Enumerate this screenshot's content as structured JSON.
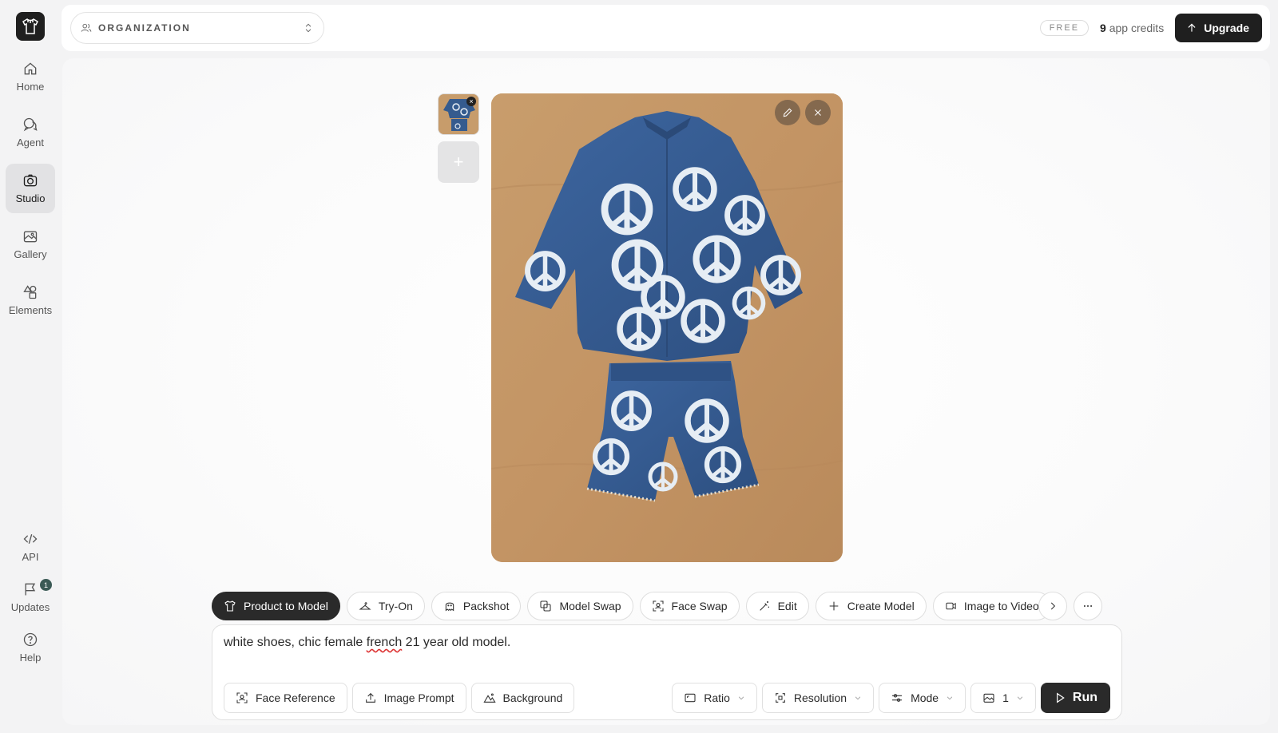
{
  "sidebar": {
    "items": [
      {
        "label": "Home",
        "icon": "home-icon"
      },
      {
        "label": "Agent",
        "icon": "chat-icon"
      },
      {
        "label": "Studio",
        "icon": "camera-icon",
        "active": true
      },
      {
        "label": "Gallery",
        "icon": "images-icon"
      },
      {
        "label": "Elements",
        "icon": "shapes-icon"
      }
    ],
    "bottom_items": [
      {
        "label": "API",
        "icon": "code-icon"
      },
      {
        "label": "Updates",
        "icon": "flag-icon",
        "badge": "1"
      },
      {
        "label": "Help",
        "icon": "help-icon"
      }
    ]
  },
  "header": {
    "org_label": "ORGANIZATION",
    "plan_badge": "FREE",
    "credits_count": "9",
    "credits_label": "app credits",
    "upgrade_label": "Upgrade"
  },
  "tools": [
    {
      "label": "Product to Model",
      "icon": "shirt-icon",
      "active": true
    },
    {
      "label": "Try-On",
      "icon": "hanger-icon"
    },
    {
      "label": "Packshot",
      "icon": "ghost-icon"
    },
    {
      "label": "Model Swap",
      "icon": "swap-icon"
    },
    {
      "label": "Face Swap",
      "icon": "face-scan-icon"
    },
    {
      "label": "Edit",
      "icon": "magic-wand-icon"
    },
    {
      "label": "Create Model",
      "icon": "plus-icon"
    },
    {
      "label": "Image to Video",
      "icon": "video-icon"
    }
  ],
  "prompt": {
    "text_before": "white shoes, chic female ",
    "misspelled": "french",
    "text_after": " 21 year old model.",
    "options": {
      "face_reference": "Face Reference",
      "image_prompt": "Image Prompt",
      "background": "Background",
      "ratio": "Ratio",
      "resolution": "Resolution",
      "mode": "Mode",
      "count": "1"
    },
    "run_label": "Run"
  },
  "colors": {
    "accent_dark": "#1f1f1f",
    "badge": "#3b5a55",
    "denim": "#355b8e"
  }
}
